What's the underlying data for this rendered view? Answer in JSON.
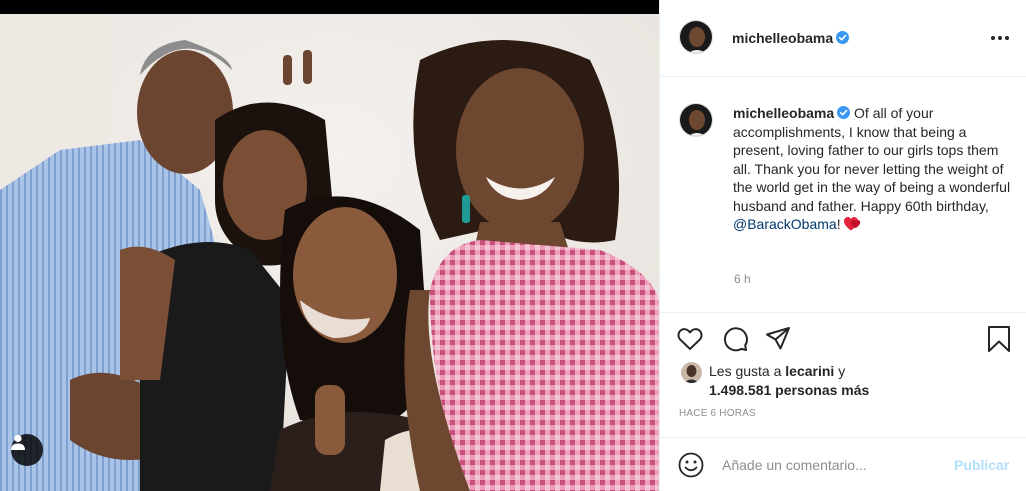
{
  "post": {
    "username": "michelleobama",
    "verified": true,
    "caption_text": " Of all of your accomplishments, I know that being a present, loving father to our girls tops them all. Thank you for never letting the weight of the world get in the way of being a wonderful husband and father. Happy 60th birthday, ",
    "caption_mention": "@BarackObama",
    "caption_end": "!",
    "relative_time": "6 h"
  },
  "likes": {
    "prefix": "Les gusta a ",
    "first_user": "lecarini",
    "connector": " y",
    "others": "1.498.581 personas más"
  },
  "timestamp": "HACE 6 HORAS",
  "comment": {
    "placeholder": "Añade un comentario...",
    "value": "",
    "publish_label": "Publicar"
  },
  "icons": {
    "more": "more-horizontal-icon",
    "like": "heart-icon",
    "comment": "comment-icon",
    "share": "paper-plane-icon",
    "save": "bookmark-icon",
    "emoji": "smiley-icon",
    "tag": "user-tag-icon",
    "verified": "verified-badge-icon",
    "caption_emoji": "red-hearts-emoji"
  },
  "colors": {
    "verified_blue": "#3897f0",
    "mention": "#00376b",
    "publish_disabled": "#b2dffc",
    "secondary_text": "#8e8e8e"
  }
}
